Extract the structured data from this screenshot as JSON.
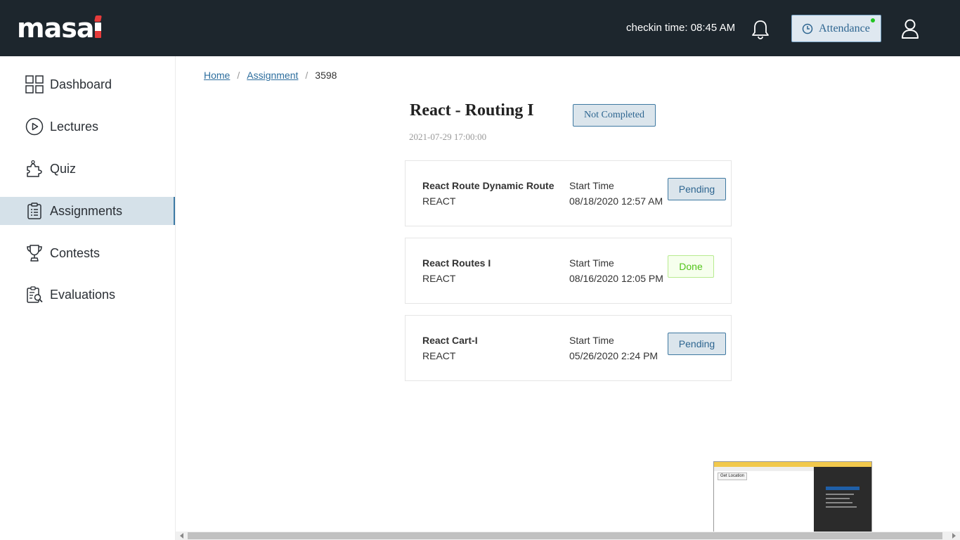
{
  "header": {
    "logo_text": "masai",
    "checkin_text": "checkin time: 08:45 AM",
    "attendance_label": "Attendance",
    "colors": {
      "bar": "#1d262d",
      "accent": "#2d6590",
      "logo_red": "#e63b3b",
      "online_dot": "#21c521"
    }
  },
  "sidebar": {
    "items": [
      {
        "label": "Dashboard",
        "icon": "grid-icon"
      },
      {
        "label": "Lectures",
        "icon": "play-circle-icon"
      },
      {
        "label": "Quiz",
        "icon": "puzzle-icon"
      },
      {
        "label": "Assignments",
        "icon": "clipboard-icon",
        "active": true
      },
      {
        "label": "Contests",
        "icon": "trophy-icon"
      },
      {
        "label": "Evaluations",
        "icon": "evaluation-icon"
      }
    ]
  },
  "breadcrumb": {
    "home": "Home",
    "assignment": "Assignment",
    "current": "3598",
    "separator": "/"
  },
  "assignment": {
    "title": "React - Routing I",
    "status": "Not Completed",
    "date": "2021-07-29 17:00:00"
  },
  "problems": [
    {
      "name": "React Route Dynamic Route",
      "category": "REACT",
      "start_label": "Start Time",
      "start_time": "08/18/2020 12:57 AM",
      "status": "Pending"
    },
    {
      "name": "React Routes I",
      "category": "REACT",
      "start_label": "Start Time",
      "start_time": "08/16/2020 12:05 PM",
      "status": "Done"
    },
    {
      "name": "React Cart-I",
      "category": "REACT",
      "start_label": "Start Time",
      "start_time": "05/26/2020 2:24 PM",
      "status": "Pending"
    }
  ],
  "thumbnail": {
    "button_label": "Get Location"
  }
}
